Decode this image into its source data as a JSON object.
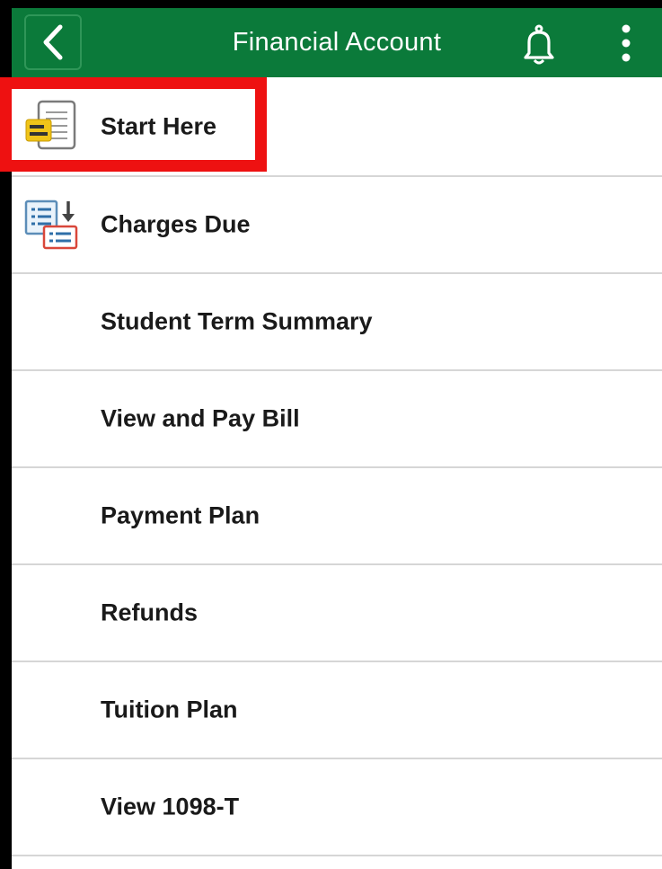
{
  "header": {
    "title": "Financial Account",
    "back_icon": "chevron-left-icon",
    "bell_icon": "bell-icon",
    "more_icon": "more-vertical-icon",
    "color": "#0b7a3a"
  },
  "menu": {
    "items": [
      {
        "label": "Start Here",
        "icon": "document-card-icon"
      },
      {
        "label": "Charges Due",
        "icon": "charges-list-icon"
      },
      {
        "label": "Student Term Summary"
      },
      {
        "label": "View and Pay Bill"
      },
      {
        "label": "Payment Plan"
      },
      {
        "label": "Refunds"
      },
      {
        "label": "Tuition Plan"
      },
      {
        "label": "View 1098-T"
      }
    ]
  },
  "highlight": {
    "target": "Start Here",
    "color": "#ee1111"
  }
}
